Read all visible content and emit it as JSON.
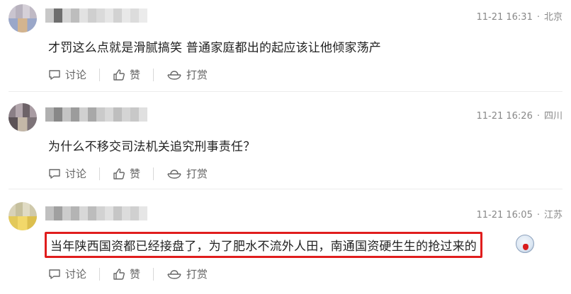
{
  "comments": [
    {
      "time": "11-21 16:31",
      "dot": "·",
      "location": "北京",
      "text": "才罚这么点就是滑腻搞笑 普通家庭都出的起应该让他倾家荡产",
      "actions": {
        "discuss": "讨论",
        "like": "赞",
        "tip": "打赏"
      }
    },
    {
      "time": "11-21 16:26",
      "dot": "·",
      "location": "四川",
      "text": "为什么不移交司法机关追究刑事责任？",
      "actions": {
        "discuss": "讨论",
        "like": "赞",
        "tip": "打赏"
      }
    },
    {
      "time": "11-21 16:05",
      "dot": "·",
      "location": "江苏",
      "text": "当年陕西国资都已经接盘了，为了肥水不流外人田，南通国资硬生生的抢过来的",
      "emoji": "crying-face-emoji",
      "highlight_color": "#e01d1d",
      "actions": {
        "discuss": "讨论",
        "like": "赞",
        "tip": "打赏"
      }
    }
  ]
}
